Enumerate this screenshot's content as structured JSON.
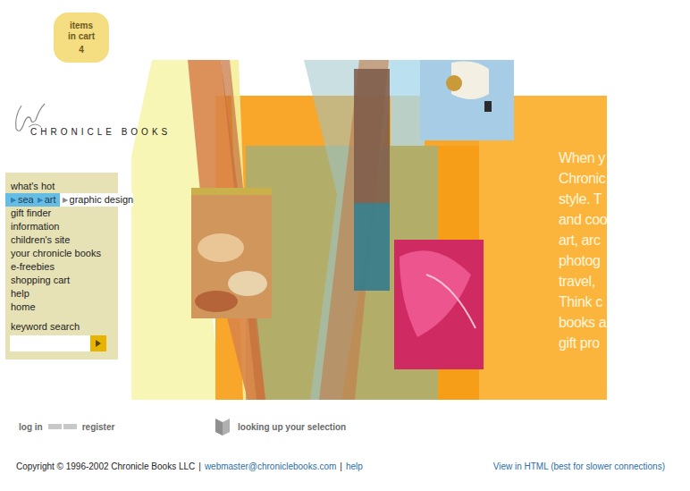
{
  "cart": {
    "lines": [
      "items",
      "in cart"
    ],
    "count": "4"
  },
  "logo": {
    "text": "CHRONICLE BOOKS"
  },
  "nav": {
    "items": [
      {
        "kind": "link",
        "label": "what's hot"
      },
      {
        "kind": "path",
        "parts": [
          {
            "arrow": "▶",
            "label": "sea",
            "selected": true
          },
          {
            "arrow": "▶",
            "label": "art",
            "selected": true
          },
          {
            "arrow": "▶",
            "label": "graphic design",
            "selected": false
          }
        ]
      },
      {
        "kind": "link",
        "label": "gift finder"
      },
      {
        "kind": "link",
        "label": "information"
      },
      {
        "kind": "link",
        "label": "children's site"
      },
      {
        "kind": "link",
        "label": "your chronicle books"
      },
      {
        "kind": "link",
        "label": "e-freebies"
      },
      {
        "kind": "link",
        "label": "shopping cart"
      },
      {
        "kind": "link",
        "label": "help"
      },
      {
        "kind": "link",
        "label": "home"
      }
    ]
  },
  "search": {
    "label": "keyword search",
    "value": ""
  },
  "hero": {
    "lines": [
      "When y",
      "Chronic",
      "style. T",
      "and coo",
      "art, arc",
      "photog",
      "travel,",
      "Think c",
      "books a",
      "gift pro"
    ]
  },
  "account": {
    "login": "log in",
    "register": "register"
  },
  "status": {
    "text": "looking up your selection"
  },
  "footer": {
    "copyright": "Copyright © 1996-2002 Chronicle Books LLC",
    "separator": "|",
    "email": "webmaster@chroniclebooks.com",
    "help": "help",
    "html_link": "View in HTML (best for slower connections)"
  }
}
